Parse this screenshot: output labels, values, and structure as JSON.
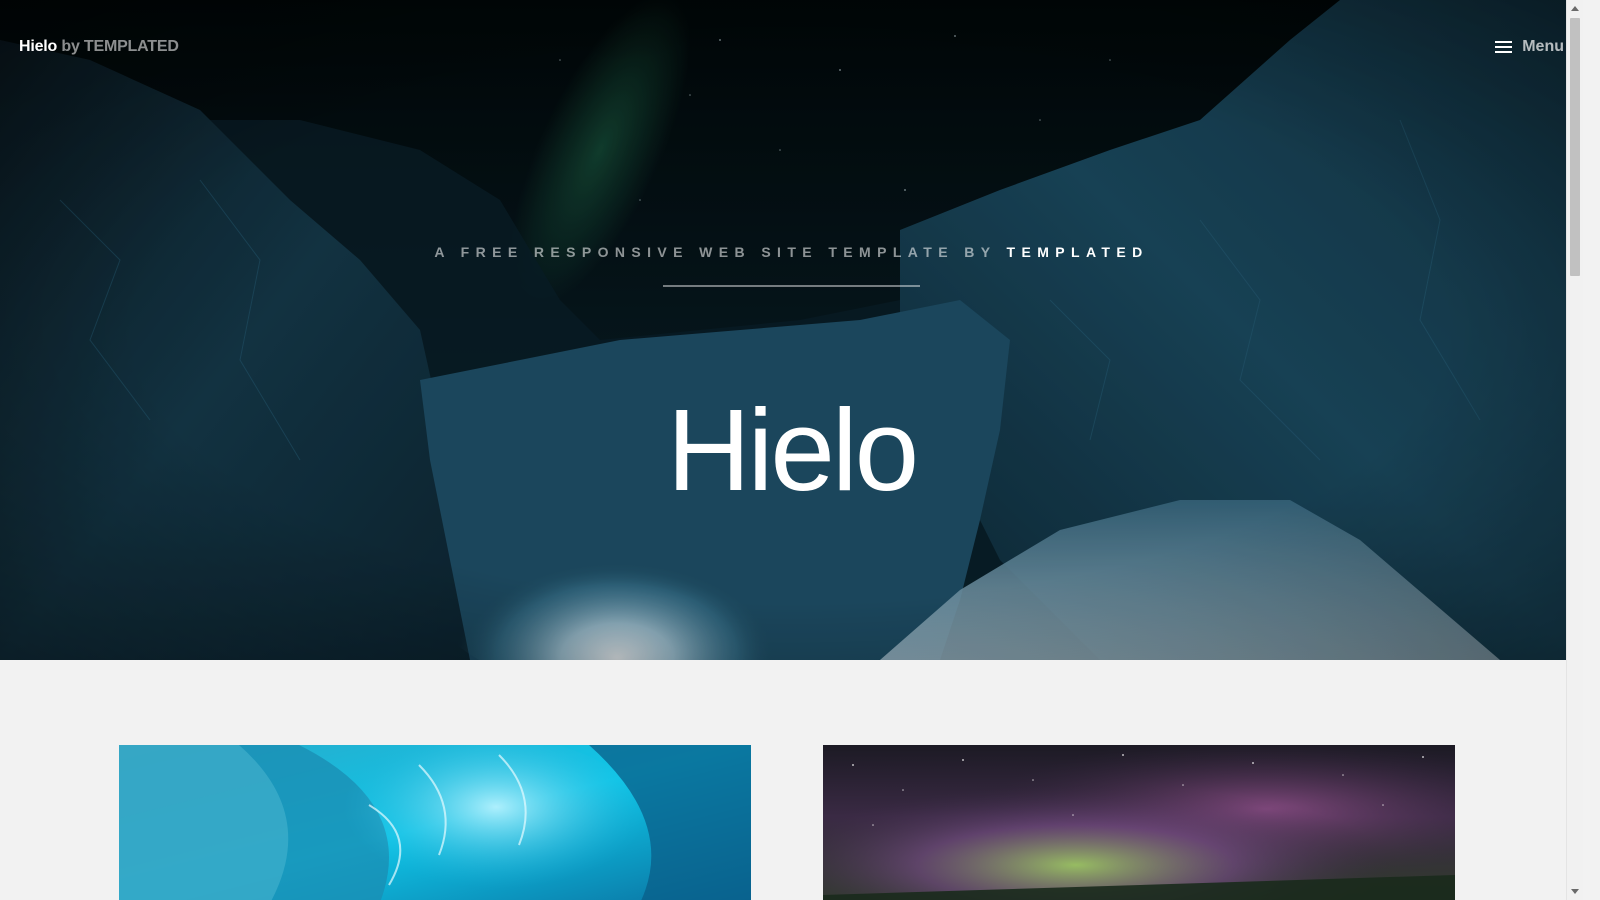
{
  "header": {
    "brand": "Hielo",
    "brand_by": "by TEMPLATED",
    "menu_label": "Menu",
    "menu_icon": "hamburger-icon"
  },
  "banner": {
    "tagline_prefix": "A free responsive web site template by",
    "tagline_emphasis": "TEMPLATED",
    "title": "Hielo",
    "background_image": "icy mountain valley at night with aurora"
  },
  "gallery": {
    "cards": [
      {
        "image": "blue ice cave"
      },
      {
        "image": "aurora over starry sky"
      }
    ]
  },
  "colors": {
    "page_background": "#f2f2f2",
    "hero_text": "#ffffff",
    "muted_text": "#9aa3a8"
  }
}
